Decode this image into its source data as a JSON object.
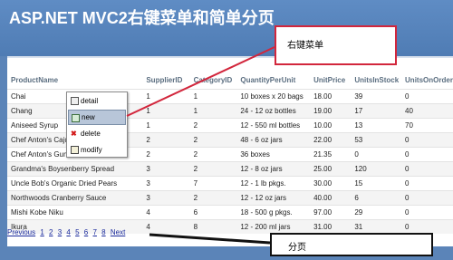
{
  "title": "ASP.NET MVC2右键菜单和简单分页",
  "columns": [
    "ProductName",
    "SupplierID",
    "CategoryID",
    "QuantityPerUnit",
    "UnitPrice",
    "UnitsInStock",
    "UnitsOnOrder"
  ],
  "rows": [
    [
      "Chai",
      "1",
      "1",
      "10 boxes x 20 bags",
      "18.00",
      "39",
      "0"
    ],
    [
      "Chang",
      "1",
      "1",
      "24 - 12 oz bottles",
      "19.00",
      "17",
      "40"
    ],
    [
      "Aniseed Syrup",
      "1",
      "2",
      "12 - 550 ml bottles",
      "10.00",
      "13",
      "70"
    ],
    [
      "Chef Anton's Cajun Seasoning",
      "2",
      "2",
      "48 - 6 oz jars",
      "22.00",
      "53",
      "0"
    ],
    [
      "Chef Anton's Gumbo Mix",
      "2",
      "2",
      "36 boxes",
      "21.35",
      "0",
      "0"
    ],
    [
      "Grandma's Boysenberry Spread",
      "3",
      "2",
      "12 - 8 oz jars",
      "25.00",
      "120",
      "0"
    ],
    [
      "Uncle Bob's Organic Dried Pears",
      "3",
      "7",
      "12 - 1 lb pkgs.",
      "30.00",
      "15",
      "0"
    ],
    [
      "Northwoods Cranberry Sauce",
      "3",
      "2",
      "12 - 12 oz jars",
      "40.00",
      "6",
      "0"
    ],
    [
      "Mishi Kobe Niku",
      "4",
      "6",
      "18 - 500 g pkgs.",
      "97.00",
      "29",
      "0"
    ],
    [
      "Ikura",
      "4",
      "8",
      "12 - 200 ml jars",
      "31.00",
      "31",
      "0"
    ]
  ],
  "pager": {
    "previous": "Previous",
    "pages": [
      "1",
      "2",
      "3",
      "4",
      "5",
      "6",
      "7",
      "8"
    ],
    "next": "Next"
  },
  "context_menu": {
    "items": [
      {
        "label": "detail",
        "icon": "detail-icon"
      },
      {
        "label": "new",
        "icon": "new-icon"
      },
      {
        "label": "delete",
        "icon": "delete-icon"
      },
      {
        "label": "modify",
        "icon": "modify-icon"
      }
    ]
  },
  "annotations": {
    "context_menu": "右键菜单",
    "paging": "分页"
  },
  "colors": {
    "banner": "#5b84b8",
    "callout_border": "#d2263c",
    "link": "#1a2a9c"
  }
}
